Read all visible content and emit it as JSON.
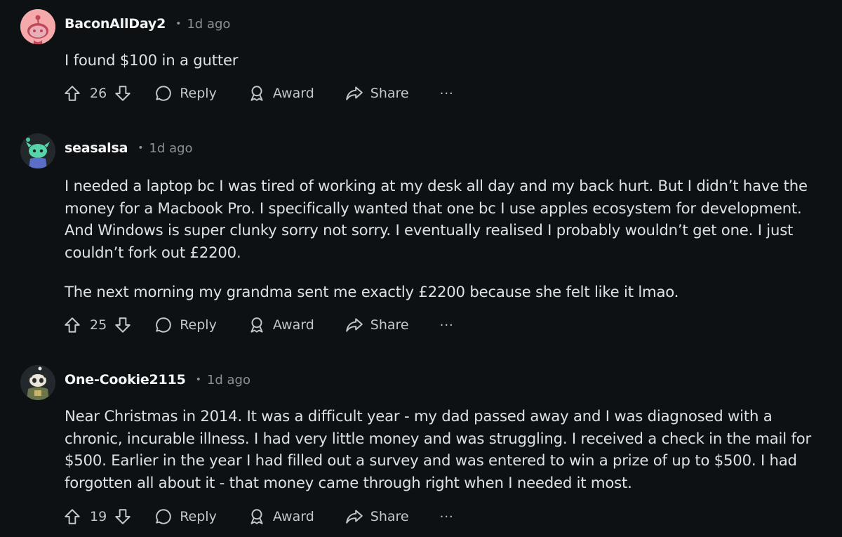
{
  "comments": [
    {
      "username": "BaconAllDay2",
      "time": "1d ago",
      "avatar_icon": "snoo-avatar-pink",
      "paragraphs": [
        "I found $100 in a gutter"
      ],
      "votes": "26"
    },
    {
      "username": "seasalsa",
      "time": "1d ago",
      "avatar_icon": "snoo-avatar-green",
      "paragraphs": [
        "I needed a laptop bc I was tired of working at my desk all day and my back hurt. But I didn’t have the money for a Macbook Pro. I specifically wanted that one bc I use apples ecosystem for development. And Windows is super clunky sorry not sorry. I eventually realised I probably wouldn’t get one. I just couldn’t fork out £2200.",
        "The next morning my grandma sent me exactly £2200 because she felt like it lmao."
      ],
      "votes": "25"
    },
    {
      "username": "One-Cookie2115",
      "time": "1d ago",
      "avatar_icon": "snoo-avatar-panda",
      "paragraphs": [
        "Near Christmas in 2014. It was a difficult year - my dad passed away and I was diagnosed with a chronic, incurable illness. I had very little money and was struggling. I received a check in the mail for $500. Earlier in the year I had filled out a survey and was entered to win a prize of up to $500. I had forgotten all about it - that money came through right when I needed it most."
      ],
      "votes": "19"
    }
  ],
  "actions": {
    "reply": "Reply",
    "award": "Award",
    "share": "Share",
    "more": "···"
  },
  "colors": {
    "background": "#0e1113",
    "text": "#dfe2e4",
    "muted": "#8a9195"
  }
}
